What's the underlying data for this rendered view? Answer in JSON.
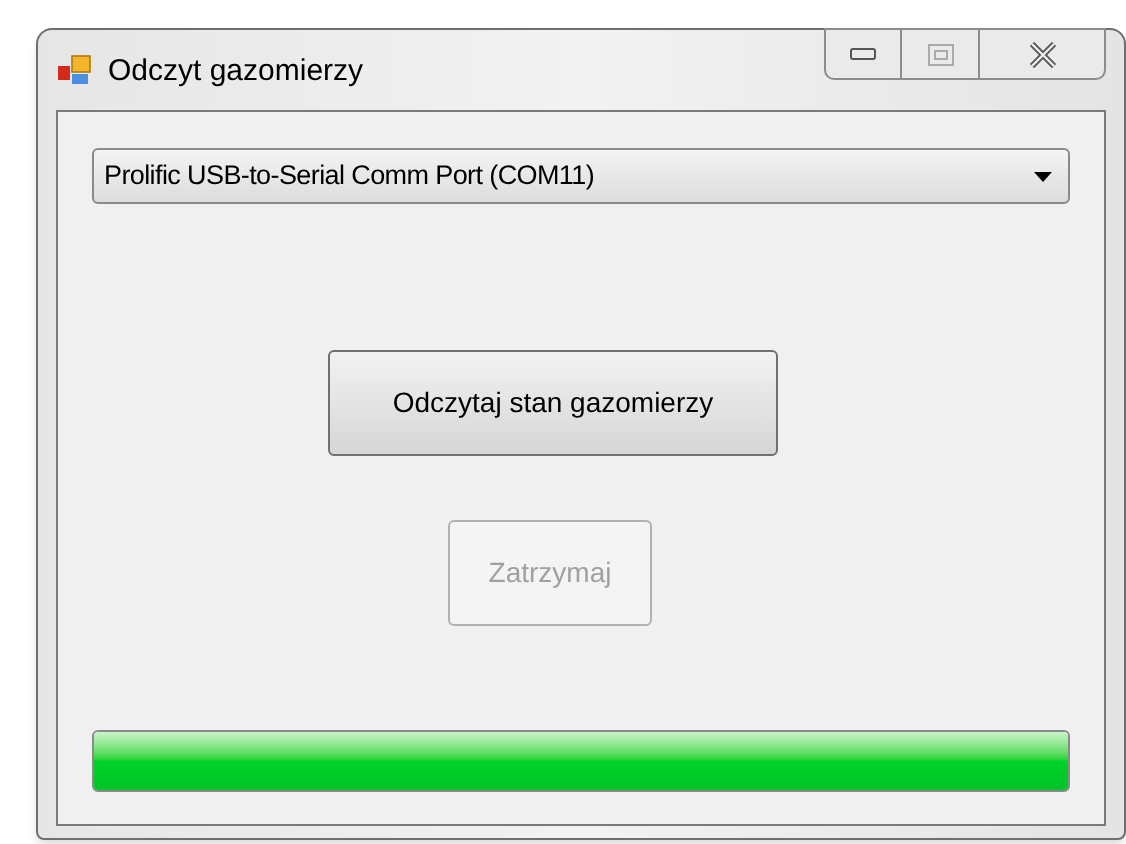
{
  "window": {
    "title": "Odczyt gazomierzy"
  },
  "port_select": {
    "value": "Prolific USB-to-Serial Comm Port (COM11)"
  },
  "buttons": [
    {
      "label": "Odczytaj stan gazomierzy",
      "disabled": false
    },
    {
      "label": "Zatrzymaj",
      "disabled": true
    }
  ],
  "progress": {
    "level": 1
  }
}
